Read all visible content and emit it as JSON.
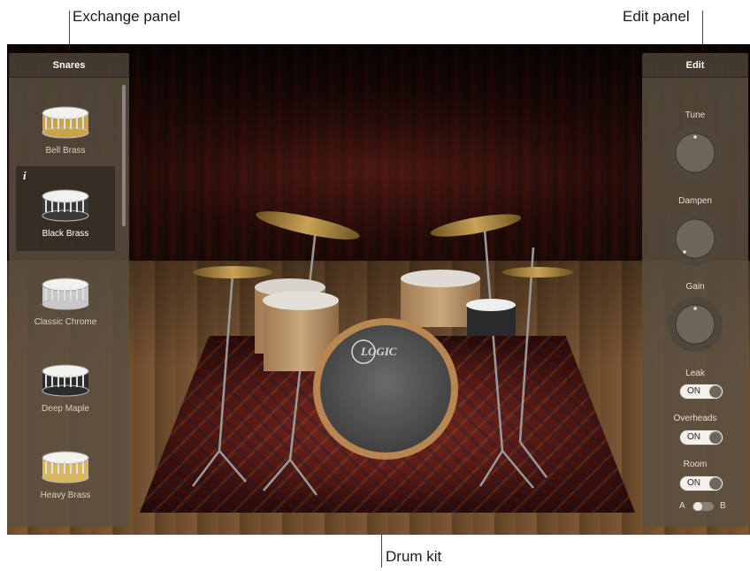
{
  "callouts": {
    "exchange_panel": "Exchange panel",
    "edit_panel": "Edit panel",
    "drum_kit": "Drum kit"
  },
  "exchange": {
    "title": "Snares",
    "items": [
      {
        "label": "Bell Brass",
        "shell": "#c9a24a",
        "selected": false
      },
      {
        "label": "Black Brass",
        "shell": "#3a3a3c",
        "selected": true
      },
      {
        "label": "Classic Chrome",
        "shell": "#c9c9c9",
        "selected": false
      },
      {
        "label": "Deep Maple",
        "shell": "#2c2c2e",
        "selected": false
      },
      {
        "label": "Heavy Brass",
        "shell": "#d8b65a",
        "selected": false
      }
    ],
    "info_icon": "info-icon"
  },
  "edit": {
    "title": "Edit",
    "knobs": [
      {
        "label": "Tune"
      },
      {
        "label": "Dampen"
      },
      {
        "label": "Gain"
      }
    ],
    "toggles": [
      {
        "label": "Leak",
        "state": "ON"
      },
      {
        "label": "Overheads",
        "state": "ON"
      },
      {
        "label": "Room",
        "state": "ON"
      }
    ],
    "ab": {
      "a": "A",
      "b": "B"
    }
  },
  "kit": {
    "bass_drum_logo": "LOGIC"
  }
}
